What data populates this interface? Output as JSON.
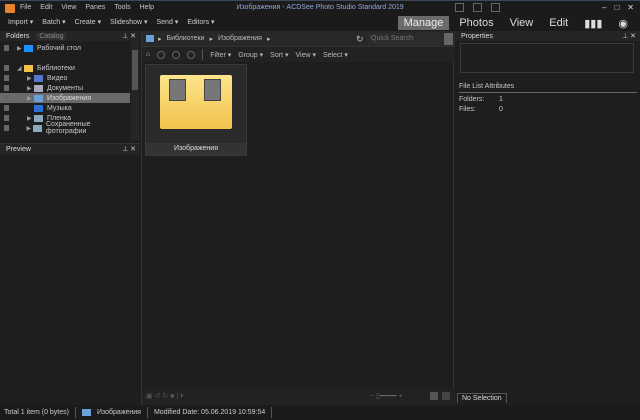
{
  "app": {
    "title": "Изображения - ACDSee Photo Studio Standard 2019"
  },
  "menu": [
    "File",
    "Edit",
    "View",
    "Panes",
    "Tools",
    "Help"
  ],
  "toolbar": {
    "tools": [
      "Import ▾",
      "Batch ▾",
      "Create ▾",
      "Slideshow ▾",
      "Send ▾",
      "Editors ▾"
    ],
    "modes": [
      "Manage",
      "Photos",
      "View",
      "Edit"
    ]
  },
  "folders": {
    "tabs": [
      "Folders",
      "Catalog"
    ],
    "items": [
      {
        "label": "Рабочий стол",
        "expand": "▶",
        "color": "#1e90ff"
      },
      {
        "label": "Библиотеки",
        "expand": "◢",
        "color": "#f2c24d"
      },
      {
        "label": "Видео",
        "expand": "▶",
        "color": "#5577cc"
      },
      {
        "label": "Документы",
        "expand": "▶",
        "color": "#aab"
      },
      {
        "label": "Изображения",
        "expand": "▶",
        "color": "#6a9fd8",
        "selected": true
      },
      {
        "label": "Музыка",
        "expand": "",
        "color": "#2a6fd8"
      },
      {
        "label": "Пленка",
        "expand": "▶",
        "color": "#8ab"
      },
      {
        "label": "Сохраненные фотографии",
        "expand": "▶",
        "color": "#8ab"
      }
    ]
  },
  "preview": {
    "title": "Preview"
  },
  "browser": {
    "breadcrumb": [
      "Библиотеки",
      "Изображения"
    ],
    "search_placeholder": "Quick Search",
    "filters": [
      "Filter ▾",
      "Group ▾",
      "Sort ▾",
      "View ▾",
      "Select ▾"
    ],
    "items": [
      {
        "name": "Изображения"
      }
    ]
  },
  "properties": {
    "title": "Properties",
    "section": "File List Attributes",
    "rows": [
      {
        "label": "Folders:",
        "value": "1"
      },
      {
        "label": "Files:",
        "value": "0"
      }
    ],
    "tab": "No Selection"
  },
  "status": {
    "total": "Total 1 item  (0 bytes)",
    "folder": "Изображения",
    "modified": "Modified Date: 05.06.2019 10:59:54"
  }
}
